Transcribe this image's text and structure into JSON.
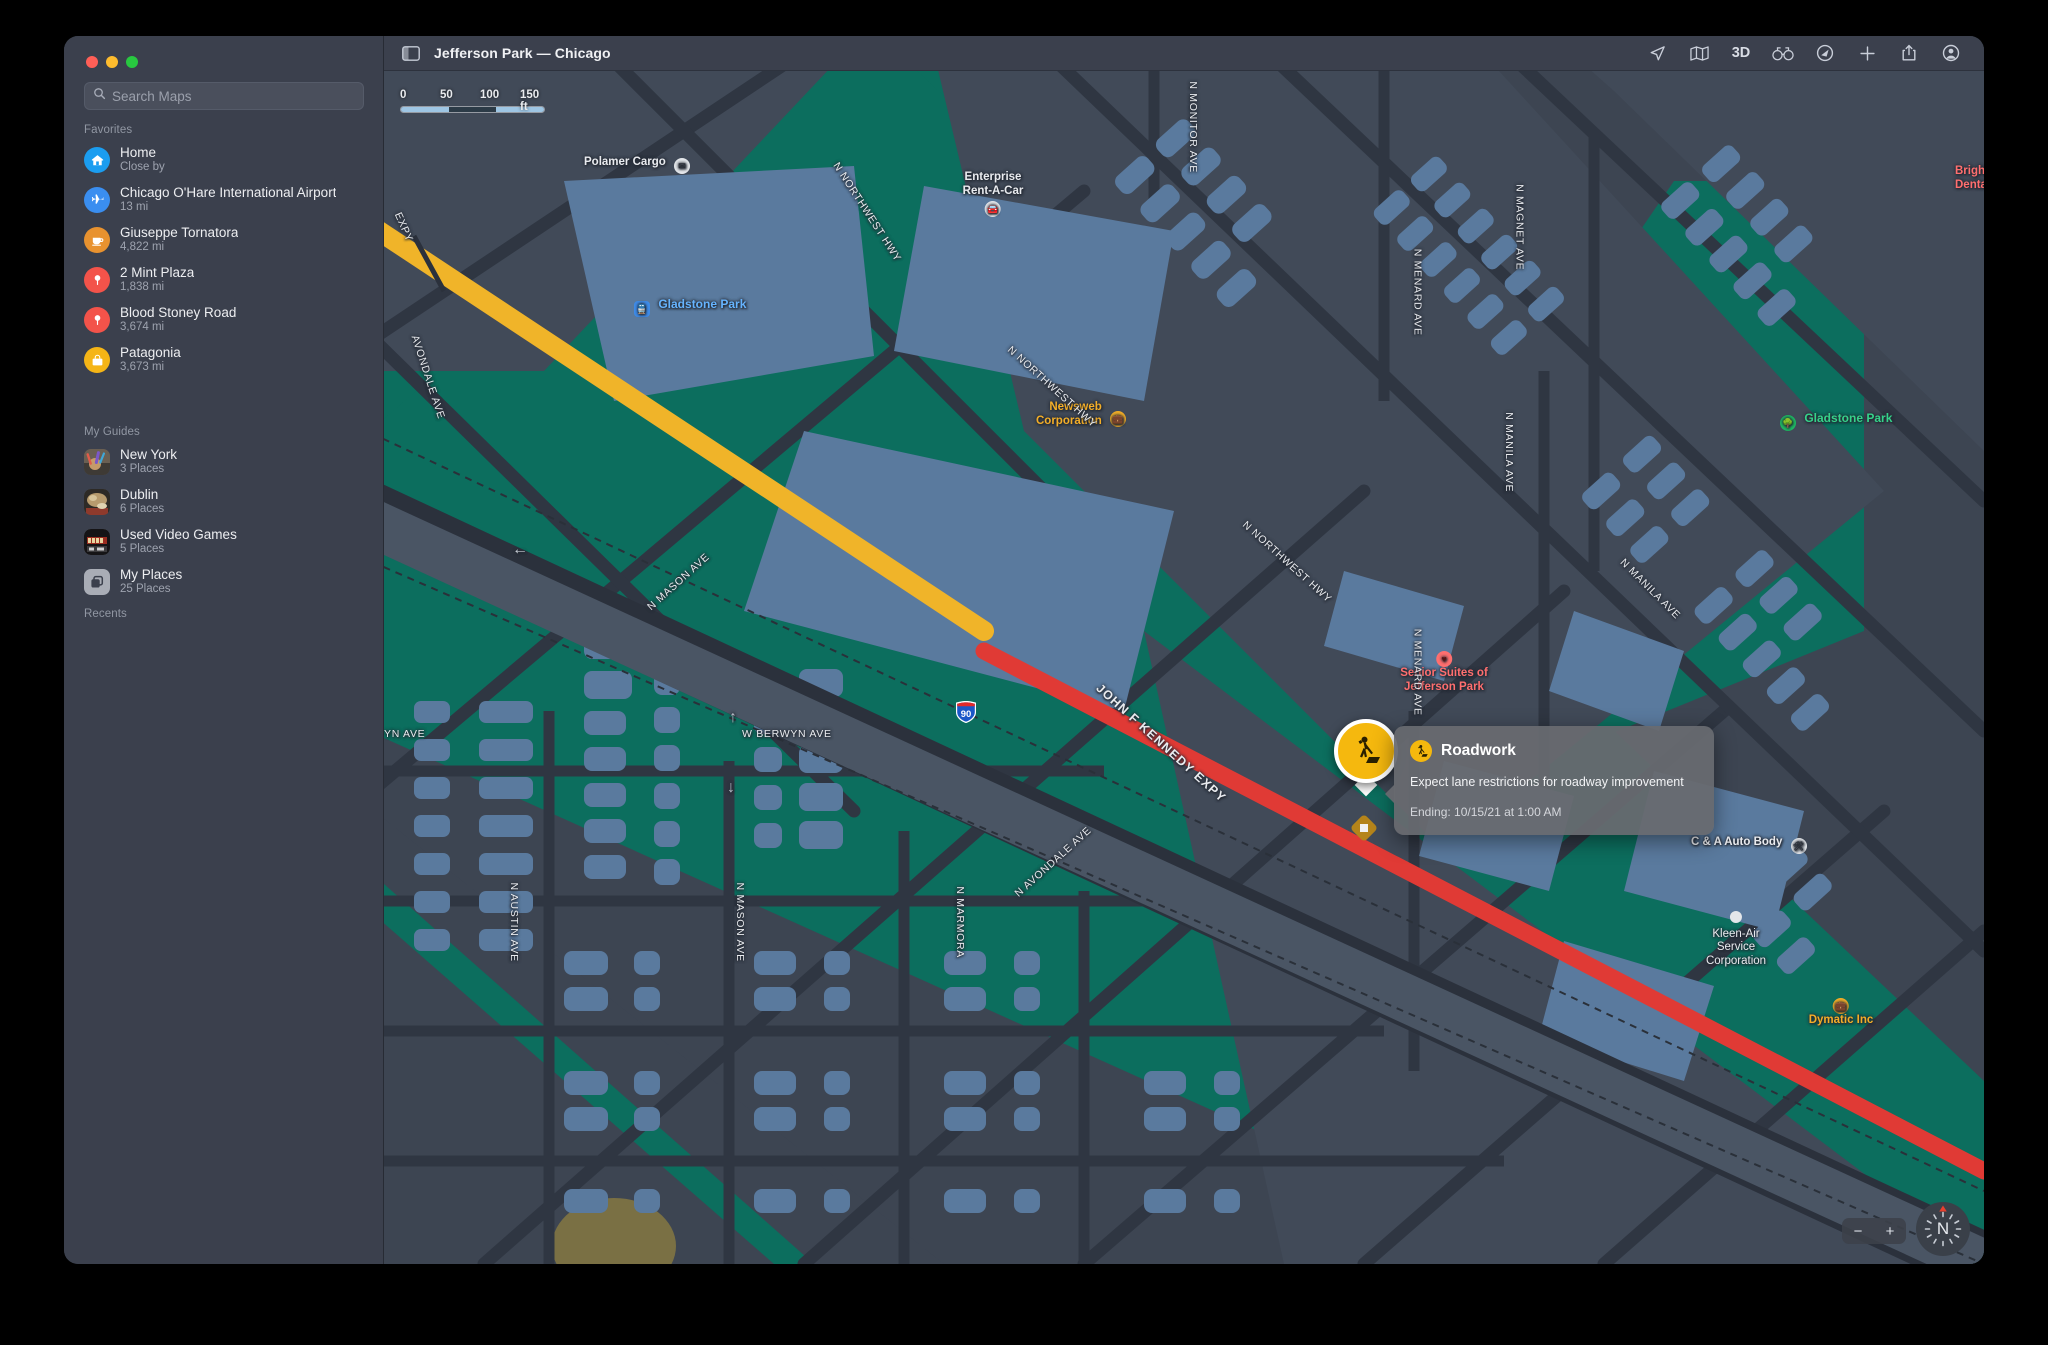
{
  "window": {
    "title": "Jefferson Park — Chicago"
  },
  "search": {
    "placeholder": "Search Maps",
    "value": "",
    "icon": "search-icon"
  },
  "sidebar": {
    "sections": [
      {
        "heading": "Favorites"
      },
      {
        "heading": "My Guides"
      },
      {
        "heading": "Recents"
      }
    ],
    "favorites_heading": "Favorites",
    "guides_heading": "My Guides",
    "recents_heading": "Recents",
    "favorites": [
      {
        "name": "Home",
        "detail": "Close by",
        "icon": "house-icon",
        "color": "#1b9df0"
      },
      {
        "name": "Chicago O'Hare International Airport",
        "detail": "13 mi",
        "icon": "airplane-icon",
        "color": "#3a8ef0"
      },
      {
        "name": "Giuseppe Tornatora",
        "detail": "4,822 mi",
        "icon": "cup-icon",
        "color": "#e8922f"
      },
      {
        "name": "2 Mint Plaza",
        "detail": "1,838 mi",
        "icon": "map-pin-icon",
        "color": "#f3534a"
      },
      {
        "name": "Blood Stoney Road",
        "detail": "3,674 mi",
        "icon": "map-pin-icon",
        "color": "#f3534a"
      },
      {
        "name": "Patagonia",
        "detail": "3,673 mi",
        "icon": "bag-icon",
        "color": "#f5b516"
      }
    ],
    "guides": [
      {
        "name": "New York",
        "detail": "3 Places",
        "icon": "photo-thumb-icon"
      },
      {
        "name": "Dublin",
        "detail": "6 Places",
        "icon": "photo-thumb-icon"
      },
      {
        "name": "Used Video Games",
        "detail": "5 Places",
        "icon": "photo-thumb-icon"
      },
      {
        "name": "My Places",
        "detail": "25 Places",
        "icon": "stack-icon"
      }
    ]
  },
  "toolbar": {
    "sidebar_toggle": "sidebar-toggle-icon",
    "buttons": [
      {
        "name": "location-arrow-icon",
        "label": ""
      },
      {
        "name": "map-mode-icon",
        "label": ""
      },
      {
        "name": "three-d-toggle",
        "label": "3D"
      },
      {
        "name": "look-around-icon",
        "label": ""
      },
      {
        "name": "directions-icon",
        "label": ""
      },
      {
        "name": "add-icon",
        "label": ""
      },
      {
        "name": "share-icon",
        "label": ""
      },
      {
        "name": "account-icon",
        "label": ""
      }
    ]
  },
  "map": {
    "scale": {
      "ticks": [
        "0",
        "50",
        "100",
        "150 ft"
      ],
      "unit": "ft"
    },
    "zoom_out": "−",
    "zoom_in": "+",
    "compass": "N",
    "pois": [
      {
        "label": "Polamer Cargo",
        "style": "white",
        "icon": "mail-icon"
      },
      {
        "label": "Enterprise\nRent-A-Car",
        "style": "white",
        "icon": "car-rental-icon"
      },
      {
        "label": "Gladstone Park",
        "style": "blue",
        "icon": "transit-icon"
      },
      {
        "label": "Newsweb\nCorporation",
        "style": "yellow",
        "icon": "briefcase-icon"
      },
      {
        "label": "Senior Suites of\nJefferson Park",
        "style": "red",
        "icon": "medical-icon"
      },
      {
        "label": "Gladstone Park",
        "style": "green",
        "icon": "tree-icon"
      },
      {
        "label": "Bright Smile\nDental",
        "style": "red",
        "icon": "medical-icon"
      },
      {
        "label": "C & A Auto Body",
        "style": "white",
        "icon": "car-repair-icon"
      },
      {
        "label": "Kleen-Air\nService\nCorporation",
        "style": "white",
        "icon": "dot-icon"
      },
      {
        "label": "Dymatic Inc",
        "style": "yellow",
        "icon": "briefcase-icon"
      }
    ],
    "poi_polamer": "Polamer Cargo",
    "poi_enterprise_1": "Enterprise",
    "poi_enterprise_2": "Rent-A-Car",
    "poi_gladstone_station": "Gladstone Park",
    "poi_newsweb_1": "Newsweb",
    "poi_newsweb_2": "Corporation",
    "poi_senior_1": "Senior Suites of",
    "poi_senior_2": "Jefferson Park",
    "poi_gladstone_park": "Gladstone Park",
    "poi_bright_1": "Bright Sm",
    "poi_bright_2": "Dental",
    "poi_ca_auto": "C & A Auto Body",
    "poi_kleen_1": "Kleen-Air",
    "poi_kleen_2": "Service",
    "poi_kleen_3": "Corporation",
    "poi_dymatic": "Dymatic Inc",
    "streets": {
      "expy_nw": "EXPY",
      "avondale_left": "AVONDALE AVE",
      "n_mason_upper": "N MASON AVE",
      "n_northwest_1": "N NORTHWEST HWY",
      "n_northwest_2": "N NORTHWEST HWY",
      "n_northwest_3": "N NORTHWEST HWY",
      "n_monitor": "N MONITOR AVE",
      "n_menard_top": "N MENARD AVE",
      "n_magnet": "N MAGNET AVE",
      "n_manila": "N MANILA AVE",
      "n_menard_bottom": "N MENARD AVE",
      "w_berwyn_left": "YN AVE",
      "w_berwyn": "W BERWYN AVE",
      "n_austin": "N AUSTIN AVE",
      "n_mason_lower": "N MASON AVE",
      "n_marmora": "N MARMORA",
      "n_avondale_lower": "N AVONDALE AVE",
      "jfk_expy": "JOHN F KENNEDY EXPY",
      "shield_90": "90"
    }
  },
  "callout": {
    "title": "Roadwork",
    "description": "Expect lane restrictions for roadway improvement",
    "ending": "Ending: 10/15/21 at 1:00 AM",
    "icon": "roadwork-icon"
  },
  "colors": {
    "accent_yellow": "#f5b80e",
    "incident_red": "#e03a35",
    "highway_orange": "#f0b429",
    "park_green": "#0c6e5e",
    "building": "#5a7a9e",
    "map_bg": "#3d4552"
  }
}
